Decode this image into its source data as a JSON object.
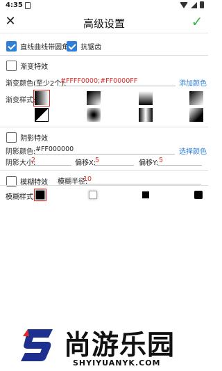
{
  "status_bar": {
    "time": "4:35"
  },
  "app_bar": {
    "title": "高级设置",
    "close_icon": "close-icon",
    "confirm_icon": "check-icon",
    "confirm_color": "#3cb14a"
  },
  "options": {
    "round_corner": {
      "label": "直线曲线带圆角",
      "checked": true
    },
    "antialias": {
      "label": "抗锯齿",
      "checked": true
    }
  },
  "gradient": {
    "toggle": {
      "label": "渐变特效",
      "checked": false
    },
    "colors_label": "渐变颜色(至少2个):",
    "colors_value": "#FFFF0000;#FF0000FF",
    "add_color": "添加颜色",
    "styles_label": "渐变样式:",
    "styles": [
      "linear-horizontal",
      "radial-corner",
      "linear-vertical",
      "linear-diagonal",
      "corner-fill",
      "radial-center",
      "symmetric-horizontal",
      "diagonal-dark"
    ]
  },
  "shadow": {
    "toggle": {
      "label": "阴影特效",
      "checked": false
    },
    "color_label": "阴影颜色:",
    "color_value": "#FF000000",
    "pick_color": "选择颜色",
    "size_label": "阴影大小:",
    "size_value": "2",
    "offset_x_label": "偏移X:",
    "offset_x_value": "5",
    "offset_y_label": "偏移Y:",
    "offset_y_value": "5"
  },
  "blur": {
    "toggle": {
      "label": "模糊特效",
      "checked": false
    },
    "radius_label": "模糊半径:",
    "radius_value": "10",
    "styles_label": "模糊样式:",
    "styles": [
      "normal",
      "outer",
      "solid",
      "inner"
    ]
  },
  "watermark": {
    "brand": "尚游乐园",
    "url": "SHYIYUANYK.COM"
  },
  "colors": {
    "accent": "#2f7fd6",
    "highlight": "#e02a2a",
    "confirm": "#3cb14a"
  }
}
